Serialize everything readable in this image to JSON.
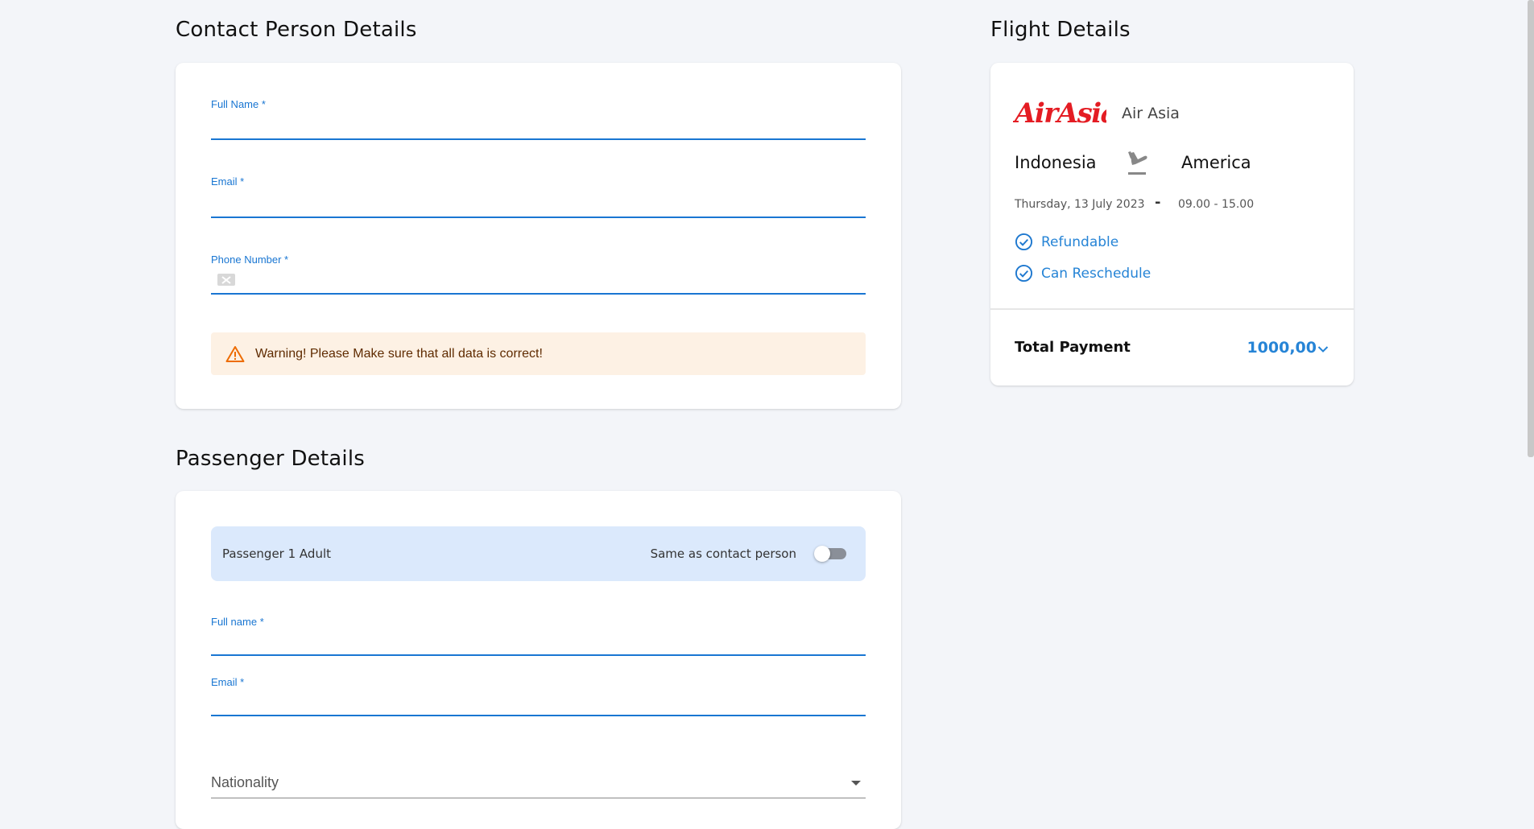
{
  "contact": {
    "title": "Contact Person Details",
    "full_name_label": "Full Name *",
    "email_label": "Email *",
    "phone_label": "Phone Number *",
    "warning_text": "Warning! Please Make sure that all data is correct!"
  },
  "passenger": {
    "title": "Passenger Details",
    "bar_title": "Passenger 1 Adult",
    "same_as_contact_label": "Same as contact person",
    "same_as_contact_on": false,
    "full_name_label": "Full name *",
    "email_label": "Email *",
    "nationality_placeholder": "Nationality"
  },
  "flight": {
    "title": "Flight Details",
    "airline_logo_text": "AirAsia",
    "airline_name": "Air Asia",
    "origin": "Indonesia",
    "destination": "America",
    "date": "Thursday, 13 July 2023",
    "separator": "-",
    "time": "09.00 - 15.00",
    "features": [
      "Refundable",
      "Can Reschedule"
    ],
    "total_label": "Total Payment",
    "total_value": "1000,00"
  },
  "colors": {
    "accent": "#1976d2",
    "warning_bg": "#fdf1e4",
    "warning_icon": "#ed6c02",
    "feature_blue": "#2684d6",
    "airline_red": "#e41c23",
    "passenger_bar_bg": "#dbe9fc"
  }
}
